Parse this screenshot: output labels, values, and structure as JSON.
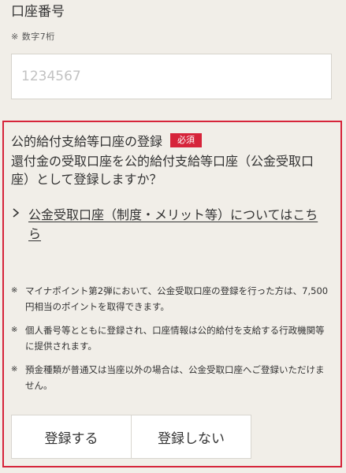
{
  "account_number": {
    "label": "口座番号",
    "note": "※ 数字7桁",
    "placeholder": "1234567",
    "value": ""
  },
  "kokin_section": {
    "title": "公的給付支給等口座の登録",
    "required_badge": "必須",
    "question": "還付金の受取口座を公的給付支給等口座（公金受取口座）として登録しますか？",
    "info_link_label": "公金受取口座（制度・メリット等）についてはこちら",
    "notes": [
      "マイナポイント第2弾において、公金受取口座の登録を行った方は、7,500円相当のポイントを取得できます。",
      "個人番号等とともに登録され、口座情報は公的給付を支給する行政機関等に提供されます。",
      "預金種類が普通又は当座以外の場合は、公金受取口座へご登録いただけません。"
    ],
    "note_mark": "※",
    "buttons": {
      "register": "登録する",
      "not_register": "登録しない"
    }
  },
  "colors": {
    "background": "#f1eee8",
    "accent_red": "#d6243a",
    "text": "#333333"
  },
  "icons": {
    "link_chevron": "chevron-right-icon"
  }
}
